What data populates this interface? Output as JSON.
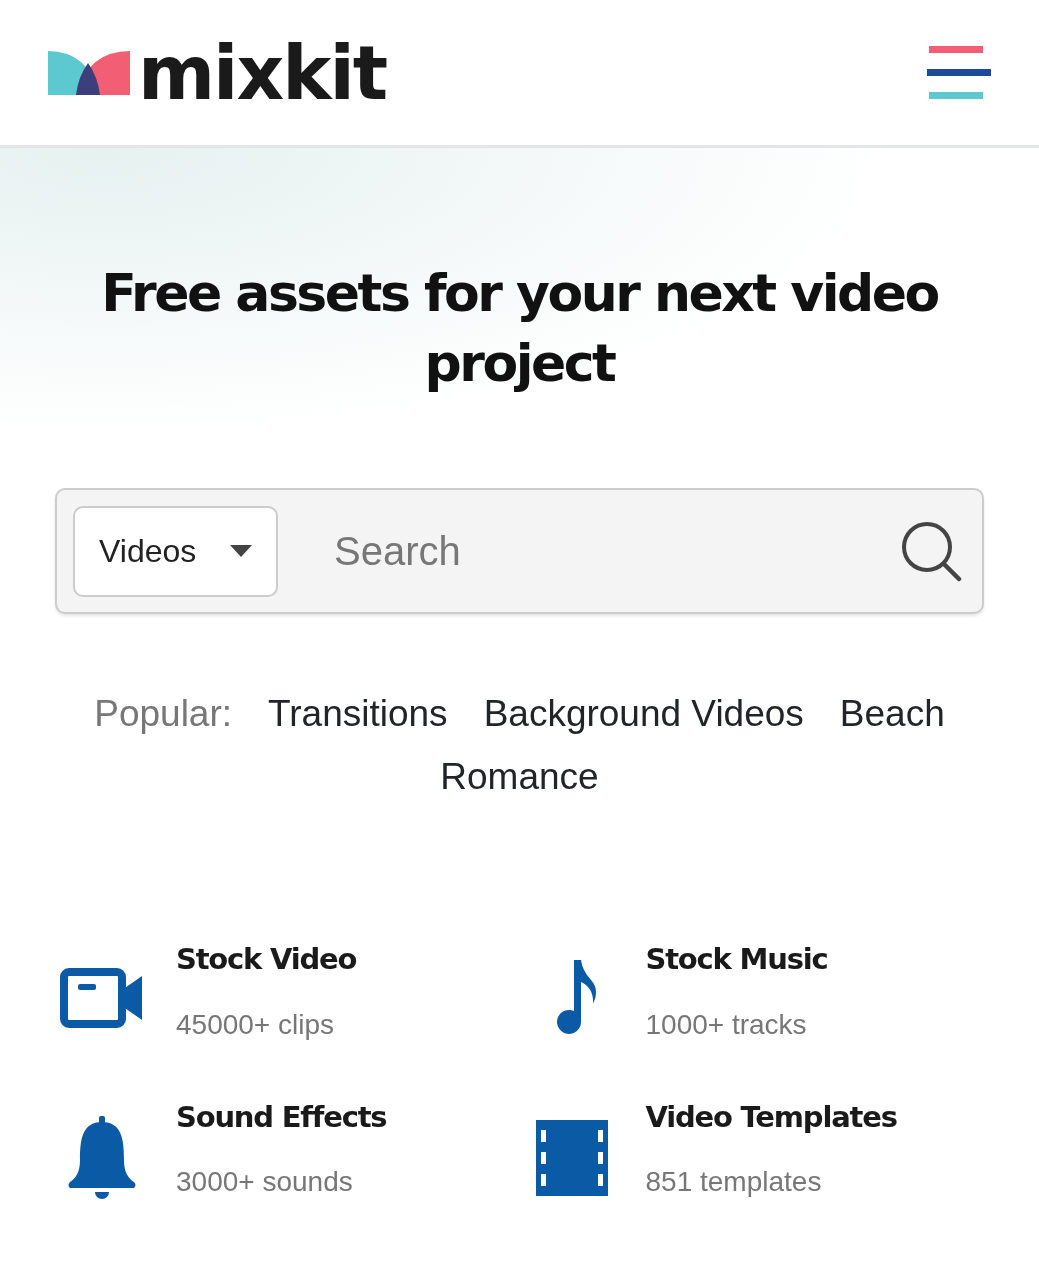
{
  "header": {
    "logo_text": "mixkit"
  },
  "hero": {
    "title": "Free assets for your next video project"
  },
  "search": {
    "category": "Videos",
    "placeholder": "Search"
  },
  "popular": {
    "label": "Popular:",
    "tags": [
      "Transitions",
      "Background Videos",
      "Beach",
      "Romance"
    ]
  },
  "categories": [
    {
      "kind": "video",
      "title": "Stock Video",
      "count": "45000+ clips"
    },
    {
      "kind": "music",
      "title": "Stock Music",
      "count": "1000+ tracks"
    },
    {
      "kind": "sfx",
      "title": "Sound Effects",
      "count": "3000+ sounds"
    },
    {
      "kind": "template",
      "title": "Video Templates",
      "count": "851 templates"
    }
  ]
}
